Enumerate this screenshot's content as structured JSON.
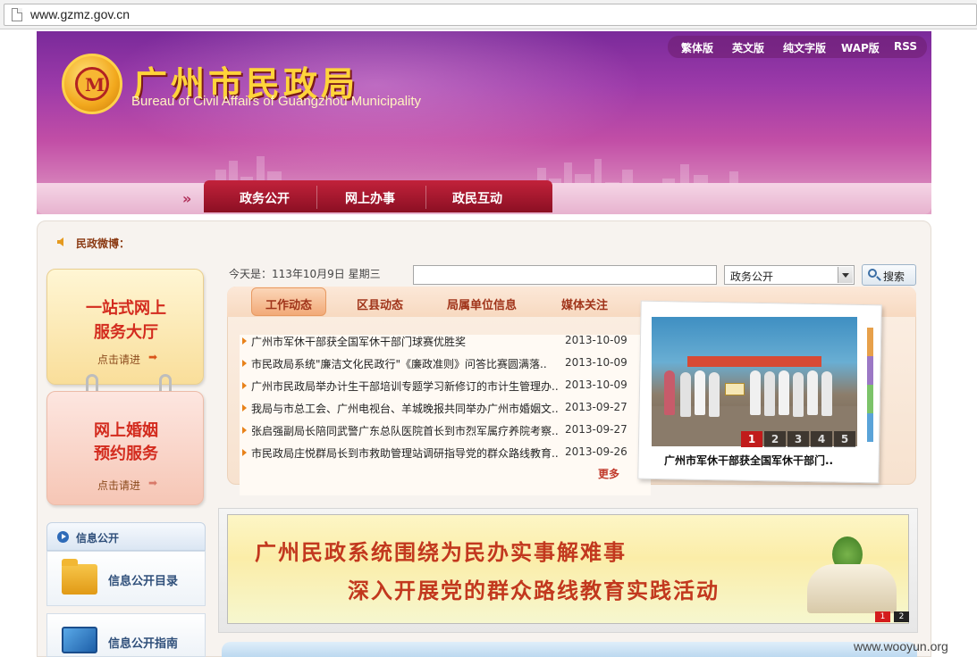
{
  "browser": {
    "url": "www.gzmz.gov.cn"
  },
  "header": {
    "title": "广州市民政局",
    "subtitle": "Bureau of Civil Affairs of Guangzhou Municipality",
    "top_links": [
      "繁体版",
      "英文版",
      "纯文字版",
      "WAP版",
      "RSS"
    ]
  },
  "nav": {
    "arrow": "»",
    "items": [
      "政务公开",
      "网上办事",
      "政民互动"
    ]
  },
  "weibo_label": "民政微博：",
  "left": {
    "card1": {
      "line1": "一站式网上",
      "line2": "服务大厅",
      "link": "点击请进"
    },
    "card2": {
      "line1": "网上婚姻",
      "line2": "预约服务",
      "link": "点击请进"
    },
    "info_header": "信息公开",
    "info_items": [
      "信息公开目录",
      "信息公开指南"
    ]
  },
  "today": "今天是：113年10月9日 星期三",
  "search": {
    "input_value": "",
    "select_value": "政务公开",
    "button": "搜索"
  },
  "news": {
    "tabs": [
      "工作动态",
      "区县动态",
      "局属单位信息",
      "媒体关注"
    ],
    "active_tab": "工作动态",
    "items": [
      {
        "title": "广州市军休干部获全国军休干部门球赛优胜奖",
        "date": "2013-10-09"
      },
      {
        "title": "市民政局系统\"廉洁文化民政行\"《廉政准则》问答比赛圆满落..",
        "date": "2013-10-09"
      },
      {
        "title": "广州市民政局举办计生干部培训专题学习新修订的市计生管理办..",
        "date": "2013-10-09"
      },
      {
        "title": "我局与市总工会、广州电视台、羊城晚报共同举办广州市婚姻文..",
        "date": "2013-09-27"
      },
      {
        "title": "张启强副局长陪同武警广东总队医院首长到市烈军属疗养院考察..",
        "date": "2013-09-27"
      },
      {
        "title": "市民政局庄悦群局长到市救助管理站调研指导党的群众路线教育..",
        "date": "2013-09-26"
      }
    ],
    "more": "更多"
  },
  "slider": {
    "pages": [
      "1",
      "2",
      "3",
      "4",
      "5"
    ],
    "active_page": "1",
    "caption": "广州市军休干部获全国军休干部门.."
  },
  "promo": {
    "line1": "广州民政系统围绕为民办实事解难事",
    "line2": "深入开展党的群众路线教育实践活动",
    "pages": [
      "1",
      "2"
    ],
    "active_page": "1"
  },
  "watermark": "www.wooyun.org",
  "colors": {
    "brand_purple": "#9c3aa9",
    "nav_red": "#a8172f",
    "title_gold": "#ffd43a",
    "accent_orange": "#e8821a"
  }
}
